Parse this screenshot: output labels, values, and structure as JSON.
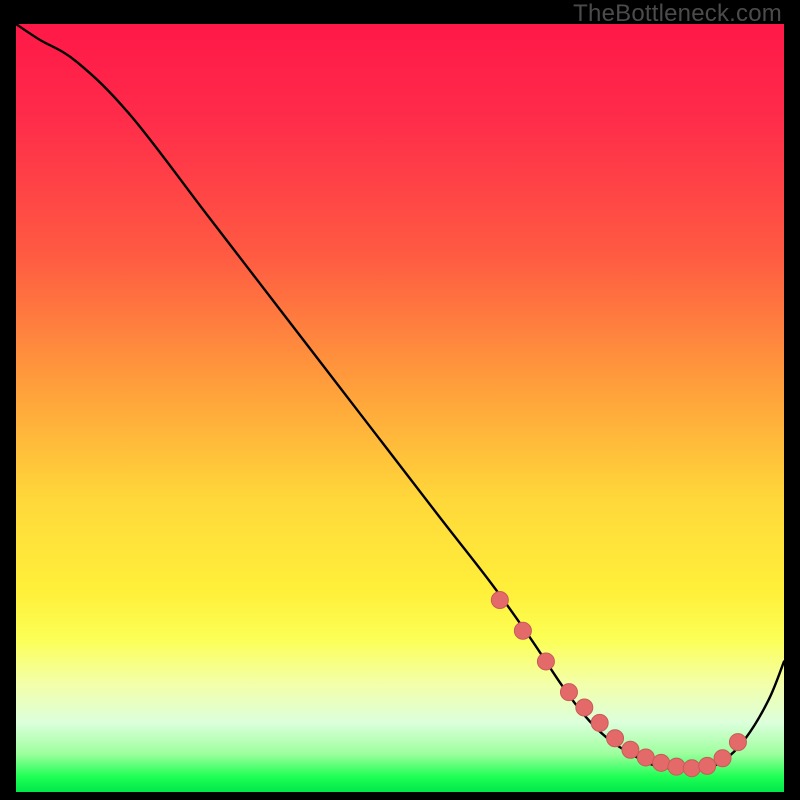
{
  "watermark": "TheBottleneck.com",
  "colors": {
    "curve_stroke": "#000000",
    "marker_fill": "#e46a6a",
    "marker_stroke": "#c95a5a"
  },
  "chart_data": {
    "type": "line",
    "title": "",
    "xlabel": "",
    "ylabel": "",
    "xlim": [
      0,
      100
    ],
    "ylim": [
      0,
      100
    ],
    "series": [
      {
        "name": "bottleneck-curve",
        "x": [
          0,
          3,
          8,
          15,
          25,
          35,
          45,
          55,
          62,
          67,
          71,
          74,
          77,
          80,
          83,
          86,
          89,
          92,
          95,
          98,
          100
        ],
        "y": [
          100,
          98,
          95,
          88,
          75,
          62,
          49,
          36,
          27,
          20,
          14,
          10,
          7,
          5,
          3.5,
          3,
          3,
          4,
          7,
          12,
          17
        ]
      }
    ],
    "markers": {
      "name": "highlight-points",
      "x": [
        63,
        66,
        69,
        72,
        74,
        76,
        78,
        80,
        82,
        84,
        86,
        88,
        90,
        92,
        94
      ],
      "y": [
        25,
        21,
        17,
        13,
        11,
        9,
        7,
        5.5,
        4.5,
        3.8,
        3.3,
        3.1,
        3.4,
        4.4,
        6.5
      ]
    }
  }
}
